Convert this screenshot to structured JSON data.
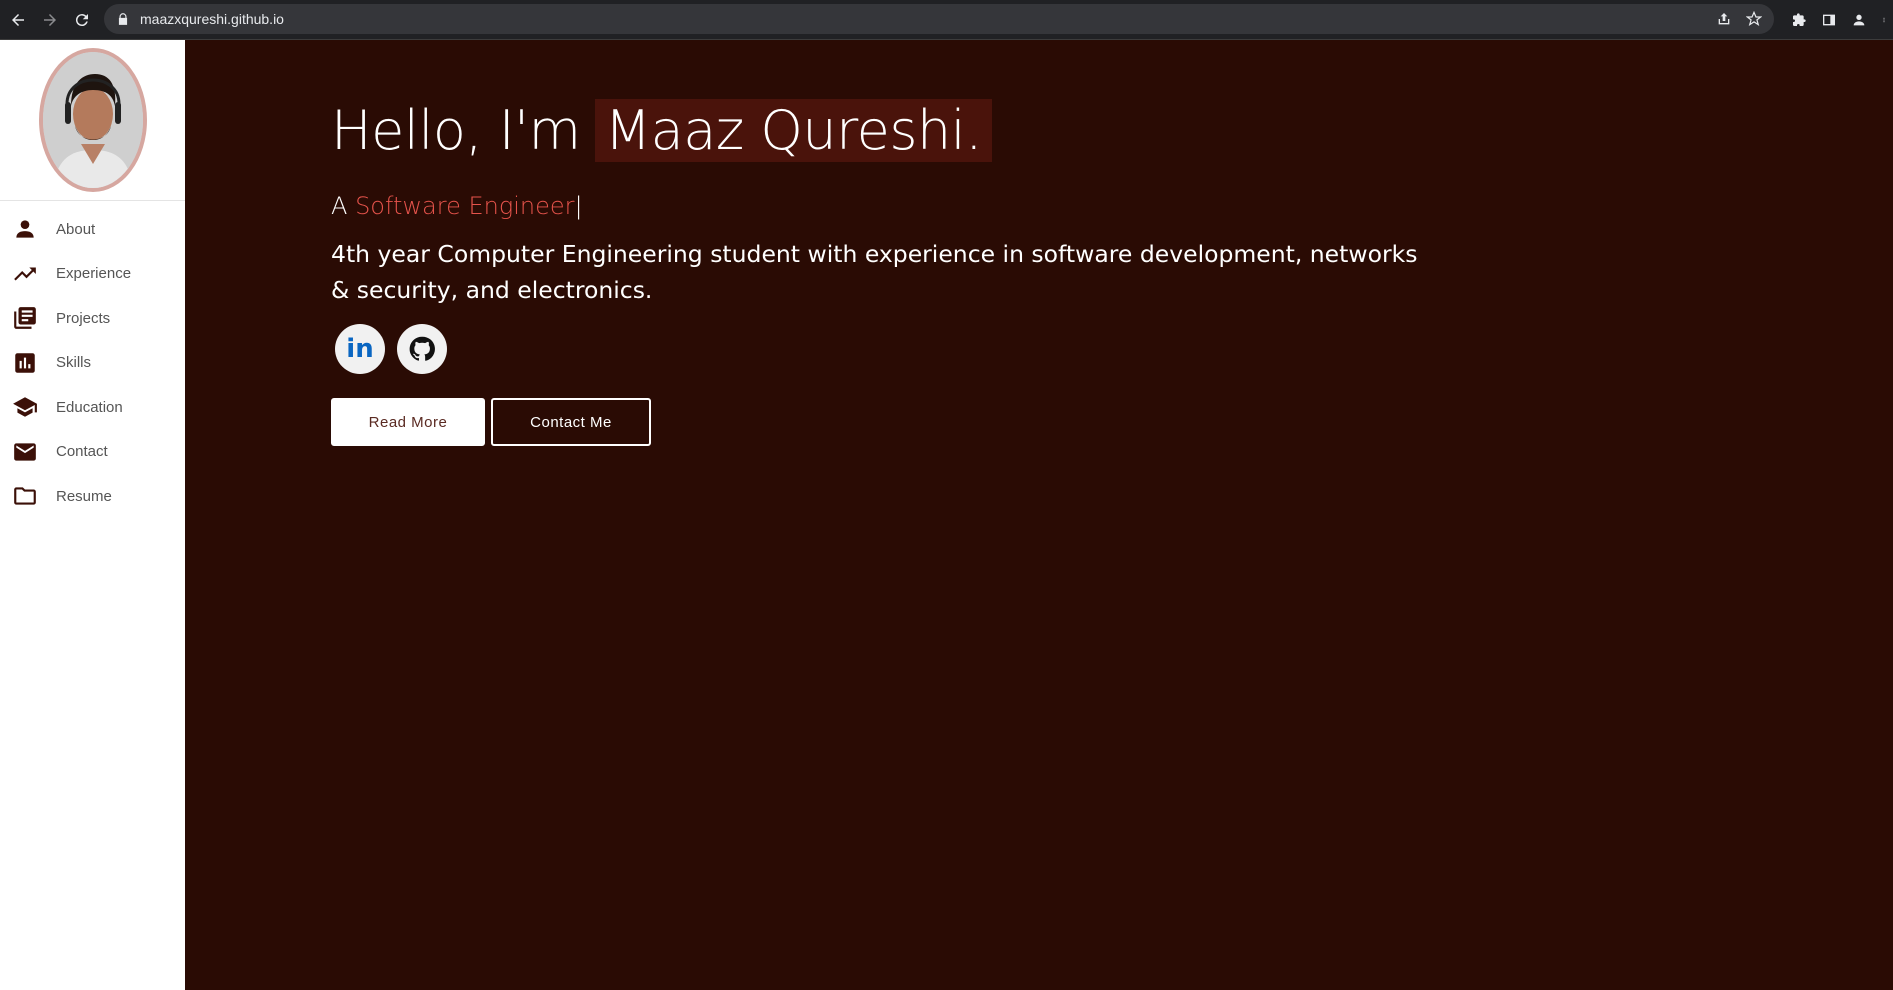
{
  "browser": {
    "url": "maazxqureshi.github.io"
  },
  "sidebar": {
    "items": [
      {
        "label": "About",
        "icon": "person-icon"
      },
      {
        "label": "Experience",
        "icon": "trending-up-icon"
      },
      {
        "label": "Projects",
        "icon": "library-books-icon"
      },
      {
        "label": "Skills",
        "icon": "bar-chart-icon"
      },
      {
        "label": "Education",
        "icon": "school-icon"
      },
      {
        "label": "Contact",
        "icon": "mail-icon"
      },
      {
        "label": "Resume",
        "icon": "folder-icon"
      }
    ]
  },
  "hero": {
    "greeting": "Hello, I'm",
    "name": "Maaz Qureshi.",
    "role_prefix": "A",
    "role": "Software Engineer",
    "cursor": "|",
    "description": "4th year Computer Engineering student with experience in software development, networks & security, and electronics.",
    "socials": [
      {
        "name": "linkedin-icon",
        "text": "in"
      },
      {
        "name": "github-icon"
      }
    ],
    "buttons": {
      "read_more": "Read More",
      "contact_me": "Contact Me"
    }
  },
  "colors": {
    "background": "#2a0b04",
    "name_highlight": "#4a130b",
    "role_accent": "#e5534b",
    "sidebar_bg": "#ffffff",
    "sidebar_icon": "#3b1008"
  }
}
